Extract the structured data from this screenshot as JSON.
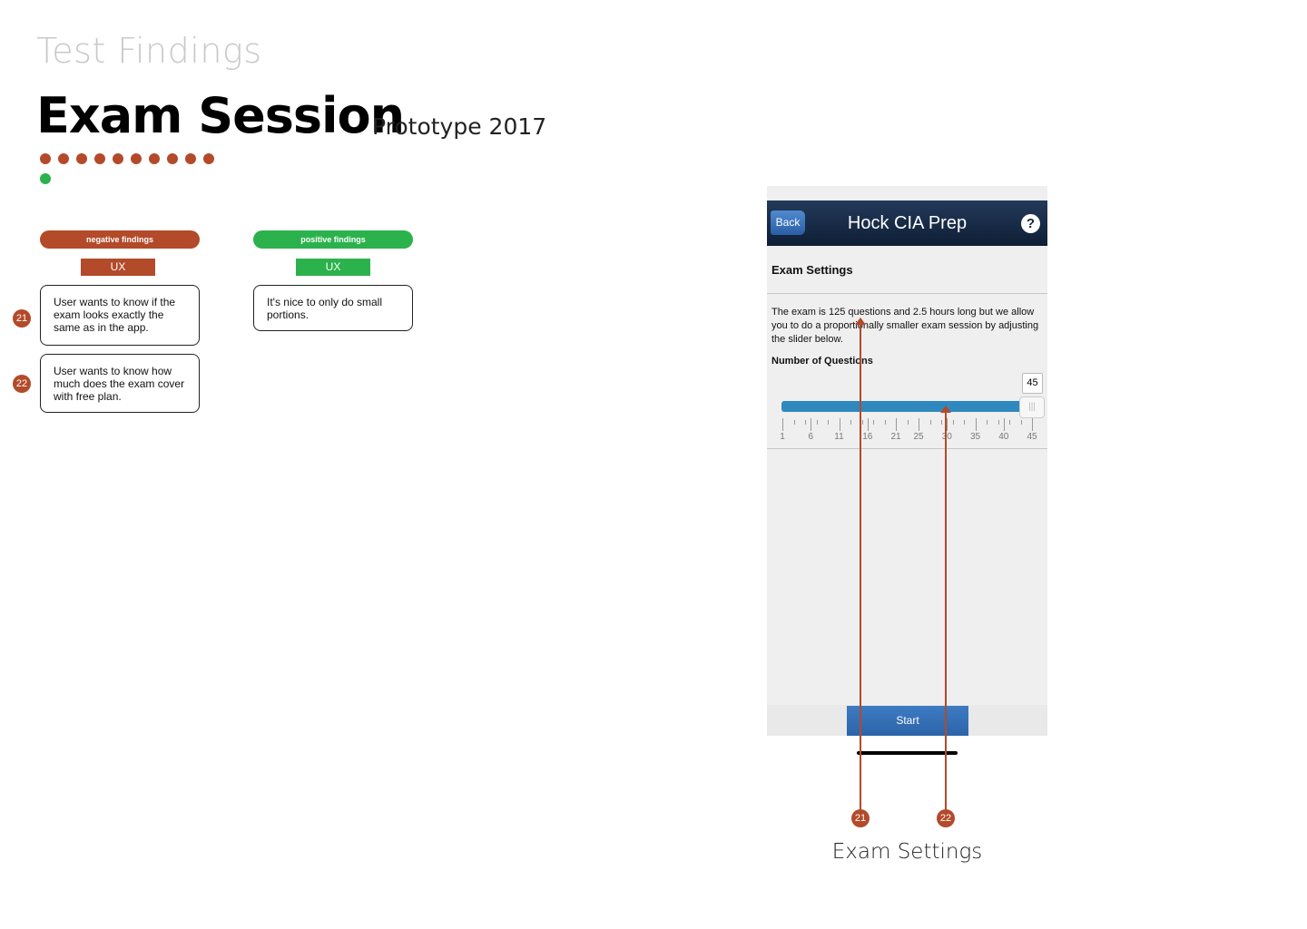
{
  "header": {
    "supertitle": "Test Findings",
    "title": "Exam Session",
    "subtitle": "Prototype 2017"
  },
  "progress": {
    "total_red": 10,
    "green": 1
  },
  "findings": {
    "negative": {
      "label": "negative findings",
      "category": "UX",
      "color": "#b34a2a",
      "items": [
        {
          "badge": "21",
          "text": "User wants to know if the exam looks exactly the same as in the app."
        },
        {
          "badge": "22",
          "text": "User wants to know how much does the exam cover with free plan."
        }
      ]
    },
    "positive": {
      "label": "positive findings",
      "category": "UX",
      "color": "#2bb24c",
      "items": [
        {
          "text": "It's nice to only do small portions."
        }
      ]
    }
  },
  "app": {
    "back_label": "Back",
    "title": "Hock CIA Prep",
    "help_icon": "question-circle-icon",
    "section_title": "Exam Settings",
    "description": "The exam is 125 questions and 2.5 hours long but we allow you to do a proportionally smaller exam session by adjusting the slider below.",
    "slider_label": "Number of Questions",
    "slider_value": "45",
    "slider_min": 1,
    "slider_max": 45,
    "tick_labels": [
      "1",
      "6",
      "11",
      "16",
      "21",
      "25",
      "30",
      "35",
      "40",
      "45"
    ],
    "start_label": "Start"
  },
  "callouts": [
    "21",
    "22"
  ],
  "caption": "Exam Settings"
}
